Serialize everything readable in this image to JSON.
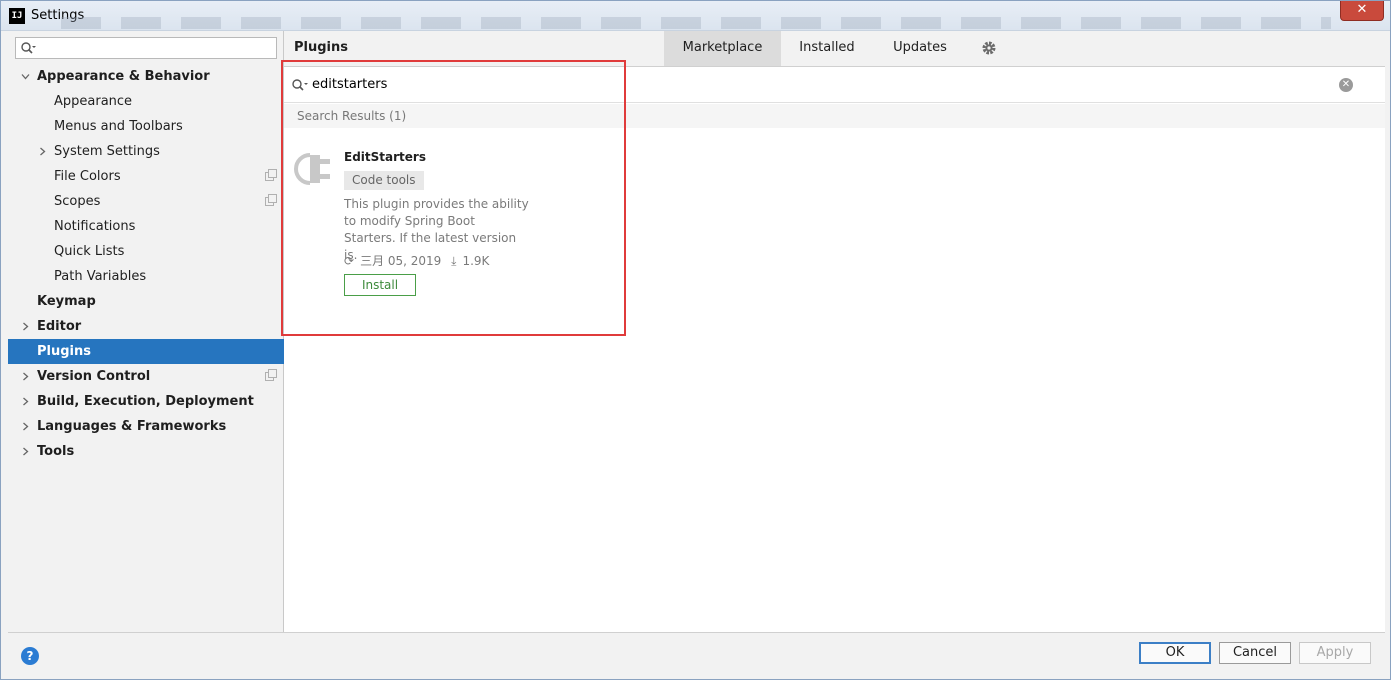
{
  "window": {
    "title": "Settings",
    "icon_label": "IJ",
    "close_label": "✕"
  },
  "sidebar": {
    "search_value": "",
    "items": [
      {
        "label": "Appearance & Behavior",
        "level": 0,
        "bold": true,
        "chevron": "down"
      },
      {
        "label": "Appearance",
        "level": 1
      },
      {
        "label": "Menus and Toolbars",
        "level": 1
      },
      {
        "label": "System Settings",
        "level": 1,
        "chevron": "right"
      },
      {
        "label": "File Colors",
        "level": 1,
        "copy_icon": true
      },
      {
        "label": "Scopes",
        "level": 1,
        "copy_icon": true
      },
      {
        "label": "Notifications",
        "level": 1
      },
      {
        "label": "Quick Lists",
        "level": 1
      },
      {
        "label": "Path Variables",
        "level": 1
      },
      {
        "label": "Keymap",
        "level": 0,
        "bold": true
      },
      {
        "label": "Editor",
        "level": 0,
        "bold": true,
        "chevron": "right"
      },
      {
        "label": "Plugins",
        "level": 0,
        "bold": true,
        "selected": true
      },
      {
        "label": "Version Control",
        "level": 0,
        "bold": true,
        "chevron": "right",
        "copy_icon": true
      },
      {
        "label": "Build, Execution, Deployment",
        "level": 0,
        "bold": true,
        "chevron": "right"
      },
      {
        "label": "Languages & Frameworks",
        "level": 0,
        "bold": true,
        "chevron": "right"
      },
      {
        "label": "Tools",
        "level": 0,
        "bold": true,
        "chevron": "right"
      }
    ]
  },
  "main": {
    "title": "Plugins",
    "tabs": [
      {
        "label": "Marketplace",
        "active": true
      },
      {
        "label": "Installed"
      },
      {
        "label": "Updates"
      }
    ],
    "search_query": "editstarters",
    "results_header": "Search Results (1)",
    "plugin": {
      "name": "EditStarters",
      "tag": "Code tools",
      "description": "This plugin provides the ability to modify Spring Boot Starters. If the latest version is.",
      "date": "三月 05, 2019",
      "downloads": "1.9K",
      "install_label": "Install"
    }
  },
  "footer": {
    "help_label": "?",
    "ok_label": "OK",
    "cancel_label": "Cancel",
    "apply_label": "Apply"
  },
  "colors": {
    "accent": "#2675bf",
    "install_green": "#3d8a3b",
    "highlight_red": "#e03b3b"
  },
  "icons": [
    "search-icon",
    "gear-icon",
    "clear-icon",
    "plugin-logo-icon",
    "refresh-icon",
    "download-icon",
    "chevron-down-icon",
    "chevron-right-icon",
    "copy-icon",
    "help-icon"
  ]
}
